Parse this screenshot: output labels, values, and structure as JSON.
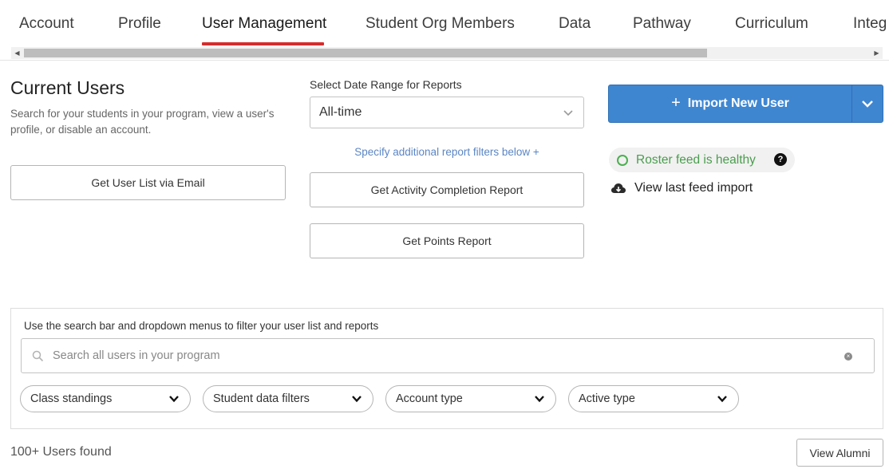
{
  "tabs": [
    {
      "label": "Account"
    },
    {
      "label": "Profile"
    },
    {
      "label": "User Management"
    },
    {
      "label": "Student Org Members"
    },
    {
      "label": "Data"
    },
    {
      "label": "Pathway"
    },
    {
      "label": "Curriculum"
    },
    {
      "label": "Integ"
    }
  ],
  "active_tab": "User Management",
  "colors": {
    "active_tab_underline": "#d52b2b",
    "primary_button": "#3f86d1",
    "healthy_status": "#4a9d4e",
    "link": "#5b86c4"
  },
  "current_users": {
    "title": "Current Users",
    "description": "Search for your students in your program, view a user's profile, or disable an account.",
    "email_button": "Get User List via Email"
  },
  "reports": {
    "date_range_label": "Select Date Range for Reports",
    "date_range_value": "All-time",
    "filters_link": "Specify additional report filters below +",
    "activity_button": "Get Activity Completion Report",
    "points_button": "Get Points Report"
  },
  "import": {
    "button_label": "Import New User",
    "plus_icon": "plus-icon",
    "dropdown_icon": "chevron-down-icon"
  },
  "roster": {
    "status": "Roster feed is healthy",
    "help": "?",
    "feed_link": "View last feed import",
    "feed_icon": "cloud-download-icon"
  },
  "filter_panel": {
    "label": "Use the search bar and dropdown menus to filter your user list and reports",
    "search_placeholder": "Search all users in your program",
    "clear_symbol": "×",
    "dropdowns": [
      {
        "label": "Class standings"
      },
      {
        "label": "Student data filters"
      },
      {
        "label": "Account type"
      },
      {
        "label": "Active type"
      }
    ]
  },
  "results": {
    "count_text": "100+ Users found",
    "alumni_button": "View Alumni"
  }
}
